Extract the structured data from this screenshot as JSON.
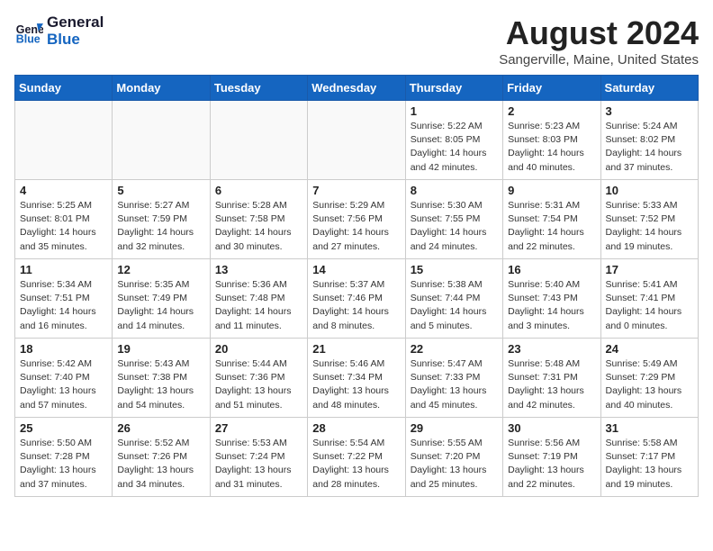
{
  "header": {
    "logo_line1": "General",
    "logo_line2": "Blue",
    "month_year": "August 2024",
    "location": "Sangerville, Maine, United States"
  },
  "days_of_week": [
    "Sunday",
    "Monday",
    "Tuesday",
    "Wednesday",
    "Thursday",
    "Friday",
    "Saturday"
  ],
  "weeks": [
    [
      {
        "day": "",
        "info": ""
      },
      {
        "day": "",
        "info": ""
      },
      {
        "day": "",
        "info": ""
      },
      {
        "day": "",
        "info": ""
      },
      {
        "day": "1",
        "info": "Sunrise: 5:22 AM\nSunset: 8:05 PM\nDaylight: 14 hours\nand 42 minutes."
      },
      {
        "day": "2",
        "info": "Sunrise: 5:23 AM\nSunset: 8:03 PM\nDaylight: 14 hours\nand 40 minutes."
      },
      {
        "day": "3",
        "info": "Sunrise: 5:24 AM\nSunset: 8:02 PM\nDaylight: 14 hours\nand 37 minutes."
      }
    ],
    [
      {
        "day": "4",
        "info": "Sunrise: 5:25 AM\nSunset: 8:01 PM\nDaylight: 14 hours\nand 35 minutes."
      },
      {
        "day": "5",
        "info": "Sunrise: 5:27 AM\nSunset: 7:59 PM\nDaylight: 14 hours\nand 32 minutes."
      },
      {
        "day": "6",
        "info": "Sunrise: 5:28 AM\nSunset: 7:58 PM\nDaylight: 14 hours\nand 30 minutes."
      },
      {
        "day": "7",
        "info": "Sunrise: 5:29 AM\nSunset: 7:56 PM\nDaylight: 14 hours\nand 27 minutes."
      },
      {
        "day": "8",
        "info": "Sunrise: 5:30 AM\nSunset: 7:55 PM\nDaylight: 14 hours\nand 24 minutes."
      },
      {
        "day": "9",
        "info": "Sunrise: 5:31 AM\nSunset: 7:54 PM\nDaylight: 14 hours\nand 22 minutes."
      },
      {
        "day": "10",
        "info": "Sunrise: 5:33 AM\nSunset: 7:52 PM\nDaylight: 14 hours\nand 19 minutes."
      }
    ],
    [
      {
        "day": "11",
        "info": "Sunrise: 5:34 AM\nSunset: 7:51 PM\nDaylight: 14 hours\nand 16 minutes."
      },
      {
        "day": "12",
        "info": "Sunrise: 5:35 AM\nSunset: 7:49 PM\nDaylight: 14 hours\nand 14 minutes."
      },
      {
        "day": "13",
        "info": "Sunrise: 5:36 AM\nSunset: 7:48 PM\nDaylight: 14 hours\nand 11 minutes."
      },
      {
        "day": "14",
        "info": "Sunrise: 5:37 AM\nSunset: 7:46 PM\nDaylight: 14 hours\nand 8 minutes."
      },
      {
        "day": "15",
        "info": "Sunrise: 5:38 AM\nSunset: 7:44 PM\nDaylight: 14 hours\nand 5 minutes."
      },
      {
        "day": "16",
        "info": "Sunrise: 5:40 AM\nSunset: 7:43 PM\nDaylight: 14 hours\nand 3 minutes."
      },
      {
        "day": "17",
        "info": "Sunrise: 5:41 AM\nSunset: 7:41 PM\nDaylight: 14 hours\nand 0 minutes."
      }
    ],
    [
      {
        "day": "18",
        "info": "Sunrise: 5:42 AM\nSunset: 7:40 PM\nDaylight: 13 hours\nand 57 minutes."
      },
      {
        "day": "19",
        "info": "Sunrise: 5:43 AM\nSunset: 7:38 PM\nDaylight: 13 hours\nand 54 minutes."
      },
      {
        "day": "20",
        "info": "Sunrise: 5:44 AM\nSunset: 7:36 PM\nDaylight: 13 hours\nand 51 minutes."
      },
      {
        "day": "21",
        "info": "Sunrise: 5:46 AM\nSunset: 7:34 PM\nDaylight: 13 hours\nand 48 minutes."
      },
      {
        "day": "22",
        "info": "Sunrise: 5:47 AM\nSunset: 7:33 PM\nDaylight: 13 hours\nand 45 minutes."
      },
      {
        "day": "23",
        "info": "Sunrise: 5:48 AM\nSunset: 7:31 PM\nDaylight: 13 hours\nand 42 minutes."
      },
      {
        "day": "24",
        "info": "Sunrise: 5:49 AM\nSunset: 7:29 PM\nDaylight: 13 hours\nand 40 minutes."
      }
    ],
    [
      {
        "day": "25",
        "info": "Sunrise: 5:50 AM\nSunset: 7:28 PM\nDaylight: 13 hours\nand 37 minutes."
      },
      {
        "day": "26",
        "info": "Sunrise: 5:52 AM\nSunset: 7:26 PM\nDaylight: 13 hours\nand 34 minutes."
      },
      {
        "day": "27",
        "info": "Sunrise: 5:53 AM\nSunset: 7:24 PM\nDaylight: 13 hours\nand 31 minutes."
      },
      {
        "day": "28",
        "info": "Sunrise: 5:54 AM\nSunset: 7:22 PM\nDaylight: 13 hours\nand 28 minutes."
      },
      {
        "day": "29",
        "info": "Sunrise: 5:55 AM\nSunset: 7:20 PM\nDaylight: 13 hours\nand 25 minutes."
      },
      {
        "day": "30",
        "info": "Sunrise: 5:56 AM\nSunset: 7:19 PM\nDaylight: 13 hours\nand 22 minutes."
      },
      {
        "day": "31",
        "info": "Sunrise: 5:58 AM\nSunset: 7:17 PM\nDaylight: 13 hours\nand 19 minutes."
      }
    ]
  ]
}
